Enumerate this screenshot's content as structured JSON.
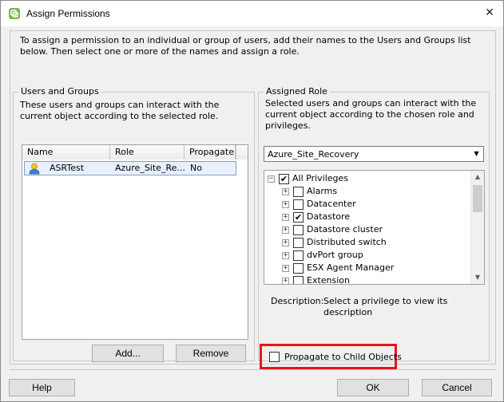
{
  "window": {
    "title": "Assign Permissions"
  },
  "intro": "To assign a permission to an individual or group of users, add their names to the Users and Groups list below. Then select one or more of the names and assign a role.",
  "users_groups": {
    "legend": "Users and Groups",
    "description": "These users and groups can interact with the current object according to the selected role.",
    "columns": [
      "Name",
      "Role",
      "Propagate"
    ],
    "rows": [
      {
        "name": "ASRTest",
        "role": "Azure_Site_Re...",
        "propagate": "No"
      }
    ],
    "add_label": "Add...",
    "remove_label": "Remove"
  },
  "assigned_role": {
    "legend": "Assigned Role",
    "description": "Selected users and groups can interact with the current object according to the chosen role and privileges.",
    "selected_role": "Azure_Site_Recovery",
    "tree": [
      {
        "label": "All Privileges",
        "checked": true,
        "level": 0,
        "expander": "−"
      },
      {
        "label": "Alarms",
        "checked": false,
        "level": 1,
        "expander": "+"
      },
      {
        "label": "Datacenter",
        "checked": false,
        "level": 1,
        "expander": "+"
      },
      {
        "label": "Datastore",
        "checked": true,
        "level": 1,
        "expander": "+"
      },
      {
        "label": "Datastore cluster",
        "checked": false,
        "level": 1,
        "expander": "+"
      },
      {
        "label": "Distributed switch",
        "checked": false,
        "level": 1,
        "expander": "+"
      },
      {
        "label": "dvPort group",
        "checked": false,
        "level": 1,
        "expander": "+"
      },
      {
        "label": "ESX Agent Manager",
        "checked": false,
        "level": 1,
        "expander": "+"
      },
      {
        "label": "Extension",
        "checked": false,
        "level": 1,
        "expander": "+"
      }
    ],
    "description_label": "Description:",
    "description_value": "Select a privilege to view its description"
  },
  "propagate": {
    "label": "Propagate to Child Objects",
    "checked": false
  },
  "footer": {
    "help_label": "Help",
    "ok_label": "OK",
    "cancel_label": "Cancel"
  },
  "colors": {
    "highlight": "#e8141c",
    "selection": "#e8f0fb"
  }
}
